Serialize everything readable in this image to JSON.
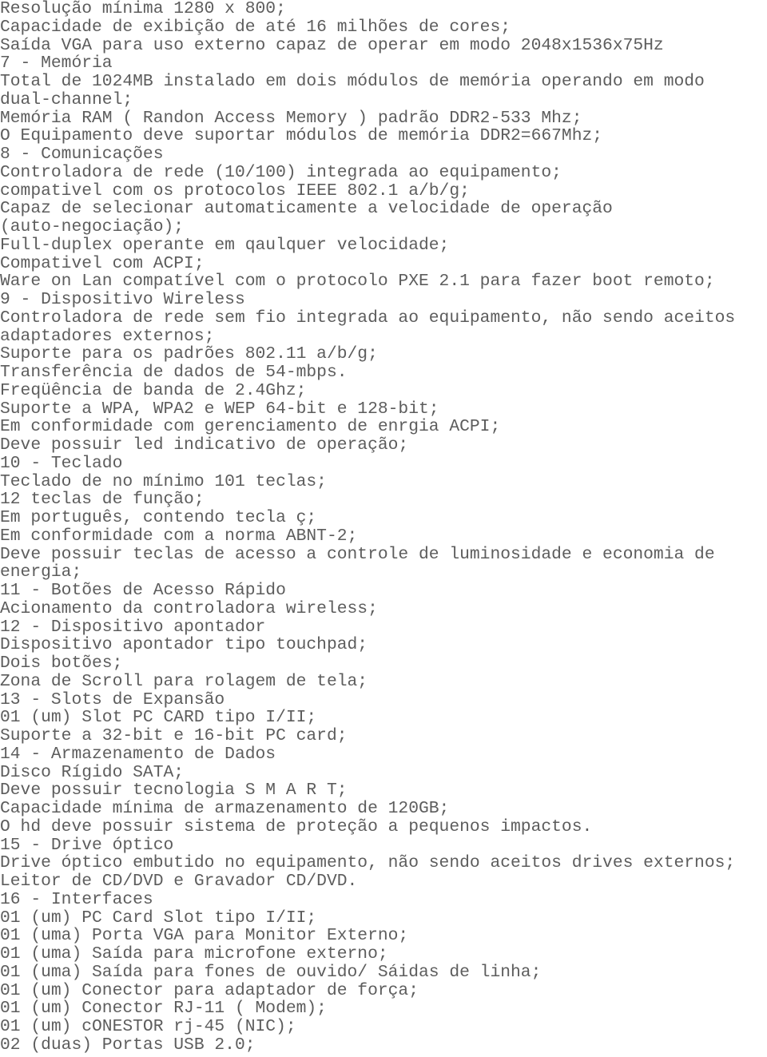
{
  "document": {
    "kind": "technical-specification-text-page",
    "language": "pt-BR",
    "text_color": "#5d5d5d",
    "background_color": "#ffffff",
    "lines": [
      "Resolução mínima 1280 x 800;",
      "Capacidade de exibição de até 16 milhões de cores;",
      "Saída VGA para uso externo capaz de operar em modo 2048x1536x75Hz",
      "7 - Memória",
      "Total de 1024MB instalado em dois módulos de memória operando em modo",
      "dual-channel;",
      "Memória RAM ( Randon Access Memory ) padrão DDR2-533 Mhz;",
      "O Equipamento deve suportar módulos de memória DDR2=667Mhz;",
      "8 - Comunicações",
      "Controladora de rede (10/100) integrada ao equipamento;",
      "compativel com os protocolos IEEE 802.1 a/b/g;",
      "Capaz de selecionar automaticamente a velocidade de operação",
      "(auto-negociação);",
      "Full-duplex operante em qaulquer velocidade;",
      "Compativel com ACPI;",
      "Ware on Lan compatível com o protocolo PXE 2.1 para fazer boot remoto;",
      "9 - Dispositivo Wireless",
      "Controladora de rede sem fio integrada ao equipamento, não sendo aceitos",
      "adaptadores externos;",
      "Suporte para os padrões 802.11 a/b/g;",
      "Transferência de dados de 54-mbps.",
      "Freqüência de banda de 2.4Ghz;",
      "Suporte a WPA, WPA2 e WEP 64-bit e 128-bit;",
      "Em conformidade com gerenciamento de enrgia ACPI;",
      "Deve possuir led indicativo de operação;",
      "10 - Teclado",
      "Teclado de no mínimo 101 teclas;",
      "12 teclas de função;",
      "Em português, contendo tecla ç;",
      "Em conformidade com a norma ABNT-2;",
      "Deve possuir teclas de acesso a controle de luminosidade e economia de",
      "energia;",
      "11 - Botões de Acesso Rápido",
      "Acionamento da controladora wireless;",
      "12 - Dispositivo apontador",
      "Dispositivo apontador tipo touchpad;",
      "Dois botões;",
      "Zona de Scroll para rolagem de tela;",
      "13 - Slots de Expansão",
      "01 (um) Slot PC CARD tipo I/II;",
      "Suporte a 32-bit e 16-bit PC card;",
      "14 - Armazenamento de Dados",
      "Disco Rígido SATA;",
      "Deve possuir tecnologia S M A R T;",
      "Capacidade mínima de armazenamento de 120GB;",
      "O hd deve possuir sistema de proteção a pequenos impactos.",
      "15 - Drive óptico",
      "Drive óptico embutido no equipamento, não sendo aceitos drives externos;",
      "Leitor de CD/DVD e Gravador CD/DVD.",
      "16 - Interfaces",
      "01 (um) PC Card Slot tipo I/II;",
      "01 (uma) Porta VGA para Monitor Externo;",
      "01 (uma) Saída para microfone externo;",
      "01 (uma) Saída para fones de ouvido/ Sáidas de linha;",
      "01 (um) Conector para adaptador de força;",
      "01 (um) Conector RJ-11 ( Modem);",
      "01 (um) cONESTOR rj-45 (NIC);",
      "02 (duas) Portas USB 2.0;"
    ]
  }
}
